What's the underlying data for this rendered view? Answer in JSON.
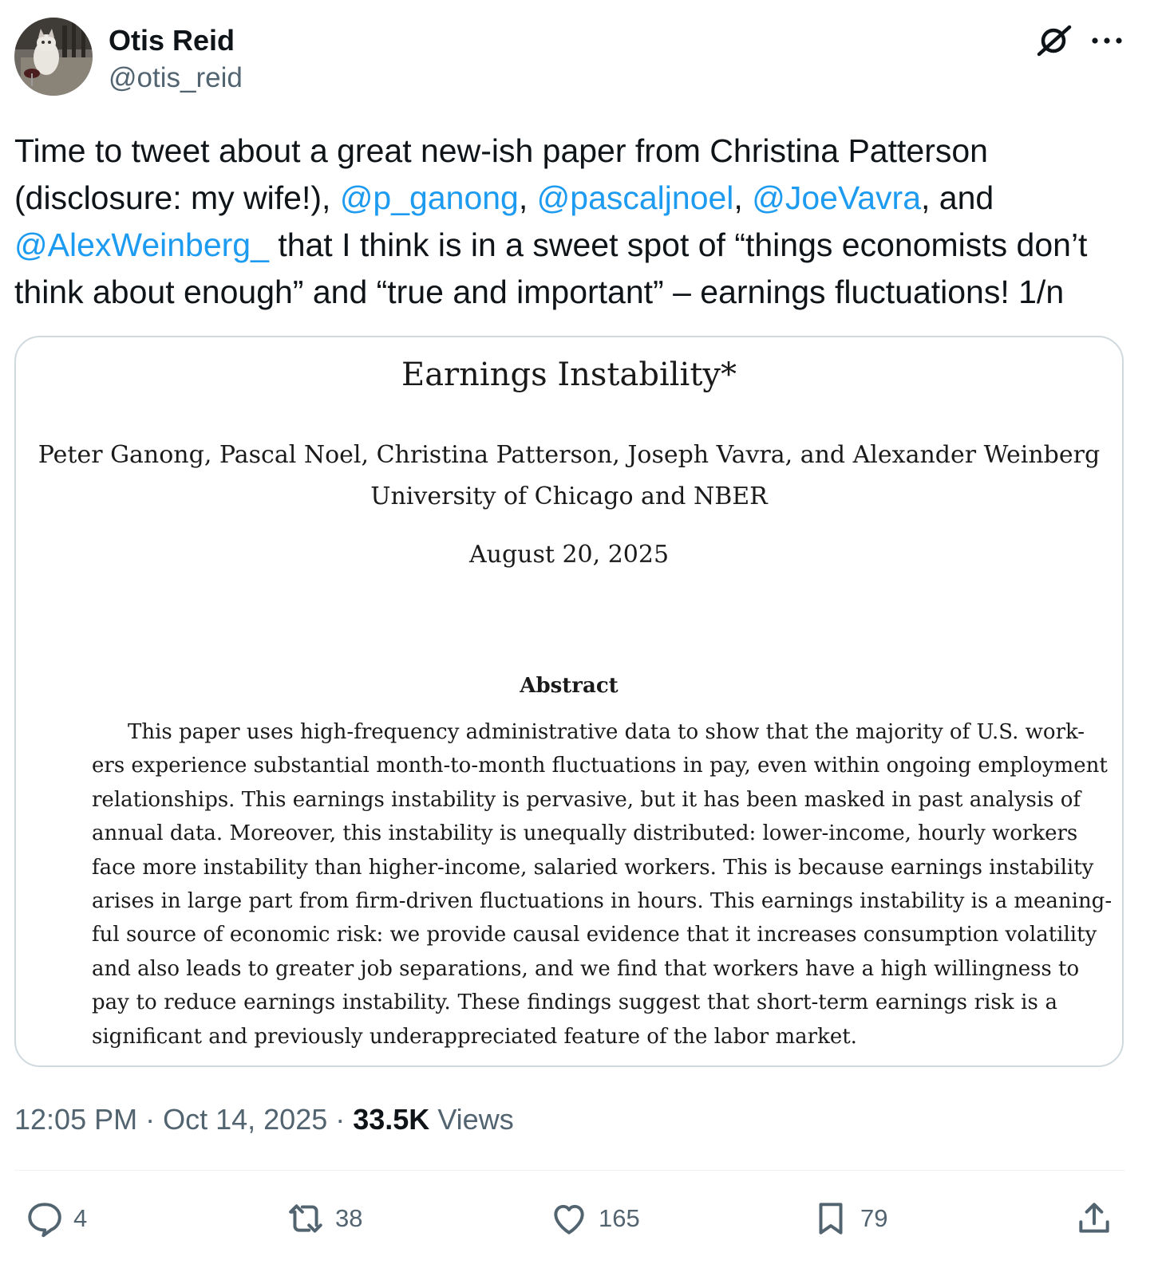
{
  "author": {
    "display_name": "Otis Reid",
    "handle": "@otis_reid"
  },
  "icons": {
    "grok": "grok-icon",
    "more": "more-icon",
    "reply": "reply-icon",
    "repost": "repost-icon",
    "like": "heart-icon",
    "bookmark": "bookmark-icon",
    "share": "share-icon"
  },
  "tweet": {
    "line1": "Time to tweet about a great new-ish paper from Christina Patterson",
    "line2_a": "(disclosure: my wife!), ",
    "mention1": "@p_ganong",
    "sep1": ", ",
    "mention2": "@pascaljnoel",
    "sep2": ", ",
    "mention3": "@JoeVavra",
    "line2_b": ", and",
    "mention4": "@AlexWeinberg_",
    "line3_b": " that I think is in a sweet spot of “things economists don’t",
    "line4": "think about enough” and “true and important” – earnings fluctuations! 1/n"
  },
  "paper": {
    "title": "Earnings Instability*",
    "authors": "Peter Ganong, Pascal Noel, Christina Patterson, Joseph Vavra, and Alexander Weinberg",
    "affiliation": "University of Chicago and NBER",
    "date": "August 20, 2025",
    "abstract_heading": "Abstract",
    "abstract_lines": [
      "This paper uses high-frequency administrative data to show that the majority of U.S. work-",
      "ers experience substantial month-to-month fluctuations in pay, even within ongoing employment",
      "relationships. This earnings instability is pervasive, but it has been masked in past analysis of",
      "annual data. Moreover, this instability is unequally distributed: lower-income, hourly workers",
      "face more instability than higher-income, salaried workers. This is because earnings instability",
      "arises in large part from firm-driven fluctuations in hours. This earnings instability is a meaning-",
      "ful source of economic risk: we provide causal evidence that it increases consumption volatility",
      "and also leads to greater job separations, and we find that workers have a high willingness to",
      "pay to reduce earnings instability. These findings suggest that short-term earnings risk is a",
      "significant and previously underappreciated feature of the labor market."
    ]
  },
  "meta": {
    "time": "12:05 PM",
    "dot1": " · ",
    "date": "Oct 14, 2025",
    "dot2": " · ",
    "views_count": "33.5K",
    "views_label": " Views"
  },
  "actions": {
    "replies": "4",
    "reposts": "38",
    "likes": "165",
    "bookmarks": "79"
  }
}
